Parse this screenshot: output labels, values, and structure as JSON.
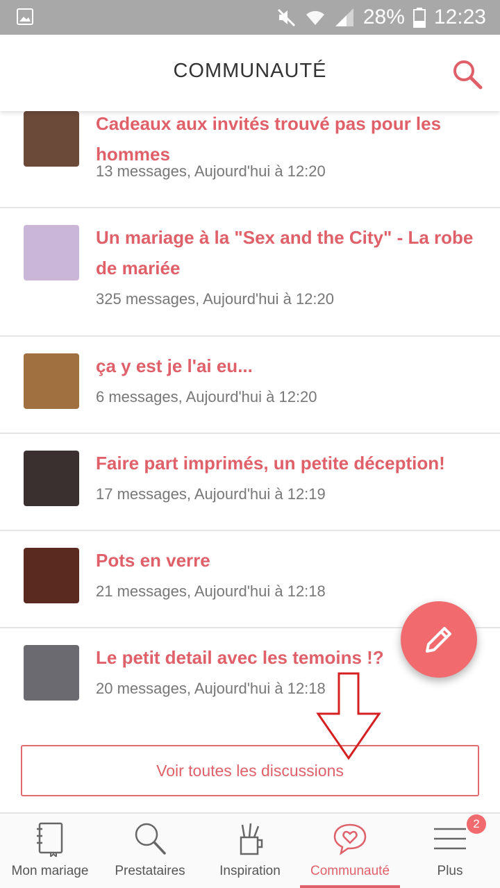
{
  "status_bar": {
    "battery": "28%",
    "time": "12:23"
  },
  "header": {
    "title": "COMMUNAUTÉ"
  },
  "threads": [
    {
      "title": "Cadeaux aux invités trouvé pas pour les hommes",
      "meta": "13 messages, Aujourd'hui à 12:20",
      "avatar_color": "#6b4a3a"
    },
    {
      "title": "Un mariage à la \"Sex and the City\" - La robe de mariée",
      "meta": "325 messages, Aujourd'hui à 12:20",
      "avatar_color": "#c9b6d8"
    },
    {
      "title": "ça y est je l'ai eu...",
      "meta": "6 messages, Aujourd'hui à 12:20",
      "avatar_color": "#a07040"
    },
    {
      "title": "Faire part imprimés, un petite déception!",
      "meta": "17 messages, Aujourd'hui à 12:19",
      "avatar_color": "#3a3030"
    },
    {
      "title": "Pots en verre",
      "meta": "21 messages, Aujourd'hui à 12:18",
      "avatar_color": "#5a2a20"
    },
    {
      "title": "Le petit detail avec les temoins !?",
      "meta": "20 messages, Aujourd'hui à 12:18",
      "avatar_color": "#6a6a70"
    }
  ],
  "see_all_label": "Voir toutes les discussions",
  "nav": {
    "items": [
      {
        "label": "Mon mariage",
        "icon": "notebook-icon"
      },
      {
        "label": "Prestataires",
        "icon": "search-icon"
      },
      {
        "label": "Inspiration",
        "icon": "pencil-cup-icon"
      },
      {
        "label": "Communauté",
        "icon": "heart-bubble-icon"
      },
      {
        "label": "Plus",
        "icon": "menu-icon"
      }
    ],
    "badge": "2"
  },
  "colors": {
    "accent": "#e0606a",
    "fab": "#f06a6e",
    "status_bar": "#a8a8a8"
  }
}
